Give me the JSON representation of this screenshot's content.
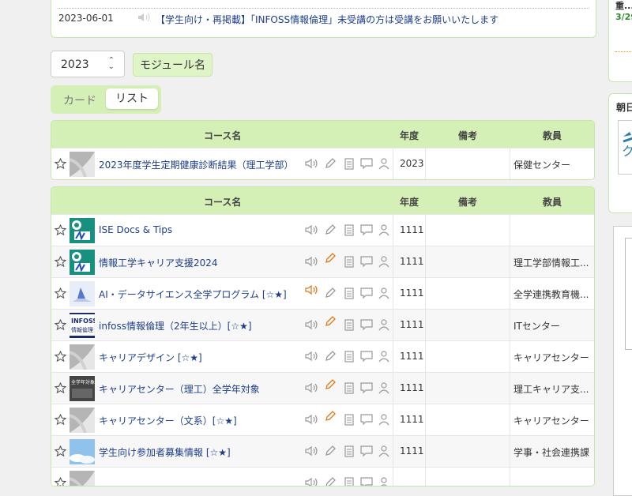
{
  "notice": {
    "date": "2023-06-01",
    "message": "【学生向け・再掲載】「INFOSS情報倫理」未受講の方は受講をお願いいたします"
  },
  "right_panel": {
    "label_top": "重...",
    "date_partial": "3/29"
  },
  "asahi_panel": {
    "label": "朝日"
  },
  "filters": {
    "year": "2023",
    "module_button": "モジュール名"
  },
  "view_toggle": {
    "card": "カード",
    "list": "リスト",
    "selected": "リスト"
  },
  "columns": {
    "course": "コース名",
    "year": "年度",
    "note": "備考",
    "teacher": "教員"
  },
  "table1": [
    {
      "name": "2023年度学生定期健康診断結果（理工学部）",
      "year": "2023",
      "teacher": "保健センター",
      "thumb": "gray-placeholder",
      "active": []
    }
  ],
  "table2": [
    {
      "name": "ISE Docs & Tips",
      "year": "1111",
      "teacher": "",
      "thumb": "teal-logo",
      "active": []
    },
    {
      "name": "情報工学キャリア支援2024",
      "year": "1111",
      "teacher": "理工学部情報工...",
      "thumb": "teal-logo",
      "active": [
        "pencil"
      ]
    },
    {
      "name": "AI・データサイエンス全学プログラム [☆★]",
      "year": "1111",
      "teacher": "全学連携教育機...",
      "thumb": "ai-image",
      "active": [
        "speaker"
      ]
    },
    {
      "name": "infoss情報倫理（2年生以上）[☆★]",
      "year": "1111",
      "teacher": "ITセンター",
      "thumb": "infoss-logo",
      "active": [
        "pencil"
      ]
    },
    {
      "name": "キャリアデザイン [☆★]",
      "year": "1111",
      "teacher": "キャリアセンター",
      "thumb": "gray-placeholder",
      "active": []
    },
    {
      "name": "キャリアセンター（理工）全学年対象",
      "year": "1111",
      "teacher": "理工キャリア支...",
      "thumb": "dark-photo",
      "active": [
        "pencil"
      ]
    },
    {
      "name": "キャリアセンター（文系）[☆★]",
      "year": "1111",
      "teacher": "キャリアセンター",
      "thumb": "gray-placeholder",
      "active": [
        "pencil"
      ]
    },
    {
      "name": "学生向け参加者募集情報 [☆★]",
      "year": "1111",
      "teacher": "学事・社会連携課",
      "thumb": "sky-photo",
      "active": []
    },
    {
      "name": "",
      "year": "",
      "teacher": "",
      "thumb": "gray-placeholder",
      "active": []
    }
  ],
  "colors": {
    "header_green": "#d4f0b6",
    "border_green": "#c8e6a8",
    "link_blue": "#1d3e8a",
    "active_orange": "#e0761a",
    "icon_gray": "#999999"
  }
}
